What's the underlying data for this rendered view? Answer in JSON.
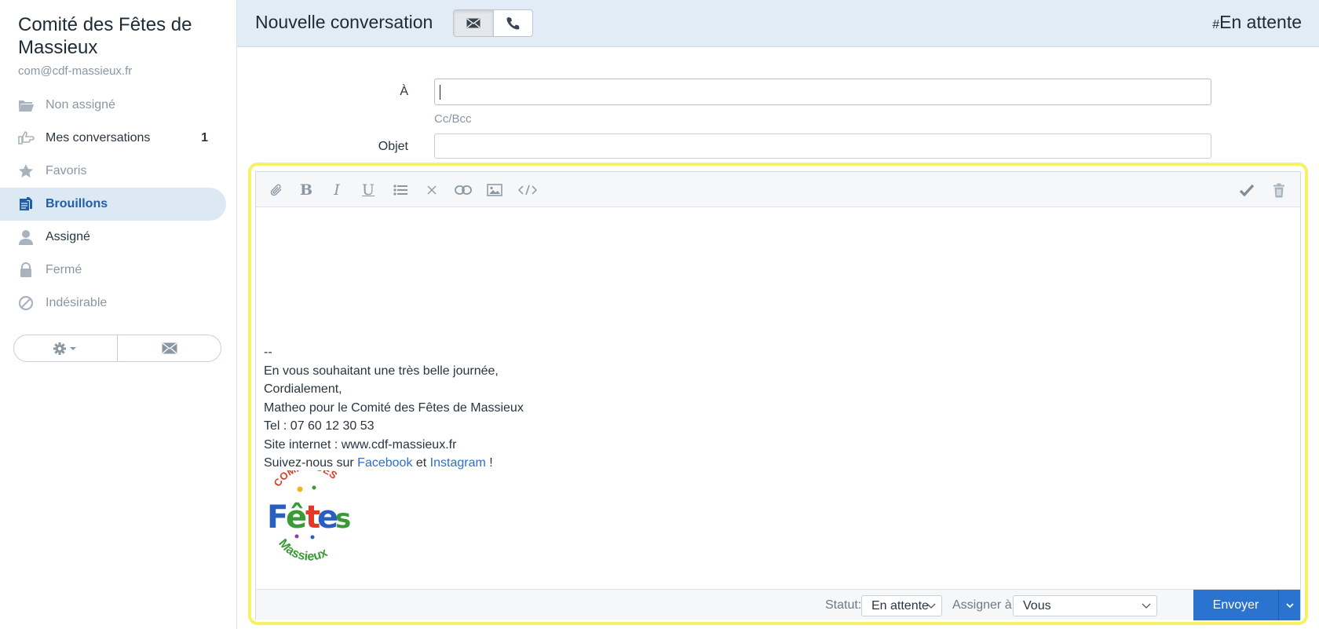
{
  "sidebar": {
    "mailbox_name": "Comité des Fêtes de Massieux",
    "mailbox_email": "com@cdf-massieux.fr",
    "items": [
      {
        "label": "Non assigné",
        "icon": "folder-open-icon"
      },
      {
        "label": "Mes conversations",
        "icon": "hand-point-right-icon",
        "count": "1"
      },
      {
        "label": "Favoris",
        "icon": "star-icon"
      },
      {
        "label": "Brouillons",
        "icon": "drafts-icon",
        "active": true
      },
      {
        "label": "Assigné",
        "icon": "user-icon"
      },
      {
        "label": "Fermé",
        "icon": "lock-icon"
      },
      {
        "label": "Indésirable",
        "icon": "ban-icon"
      }
    ],
    "buttons": [
      {
        "icon": "gear-dropdown-icon"
      },
      {
        "icon": "envelope-icon"
      }
    ]
  },
  "header": {
    "title": "Nouvelle conversation",
    "type_buttons": [
      {
        "icon": "envelope-icon",
        "active": true
      },
      {
        "icon": "phone-icon",
        "active": false
      }
    ],
    "status_hash": "#",
    "status": "En attente"
  },
  "form": {
    "to_label": "À",
    "to_value": "",
    "ccbcc_label": "Cc/Bcc",
    "subject_label": "Objet",
    "subject_value": ""
  },
  "editor": {
    "toolbar_left": [
      "paperclip-icon",
      "bold-icon",
      "italic-icon",
      "underline-icon",
      "list-icon",
      "clear-format-icon",
      "link-icon",
      "image-icon",
      "code-icon"
    ],
    "toolbar_right": [
      "check-icon",
      "trash-icon"
    ],
    "signature": {
      "separator": "--",
      "line1": "En vous souhaitant une très belle journée,",
      "line2": "Cordialement,",
      "line3": "Matheo pour le Comité des Fêtes de Massieux",
      "line4": "Tel : 07 60 12 30 53",
      "line5": "Site internet : www.cdf-massieux.fr",
      "line6_prefix": "Suivez-nous sur ",
      "facebook": "Facebook",
      "line6_mid": " et ",
      "instagram": "Instagram",
      "line6_suffix": " !"
    },
    "logo": {
      "top_text": "COMITÉ DES",
      "main_text": "Fêtes",
      "bottom_text": "Massieux"
    }
  },
  "footer": {
    "status_label": "Statut:",
    "status_value": "En attente",
    "assign_label": "Assigner à:",
    "assign_value": "Vous",
    "send_label": "Envoyer"
  },
  "colors": {
    "accent": "#2a74cf",
    "active_bg": "#dde8f5",
    "header_bg": "#e2ecf6",
    "highlight": "#f6f265"
  }
}
